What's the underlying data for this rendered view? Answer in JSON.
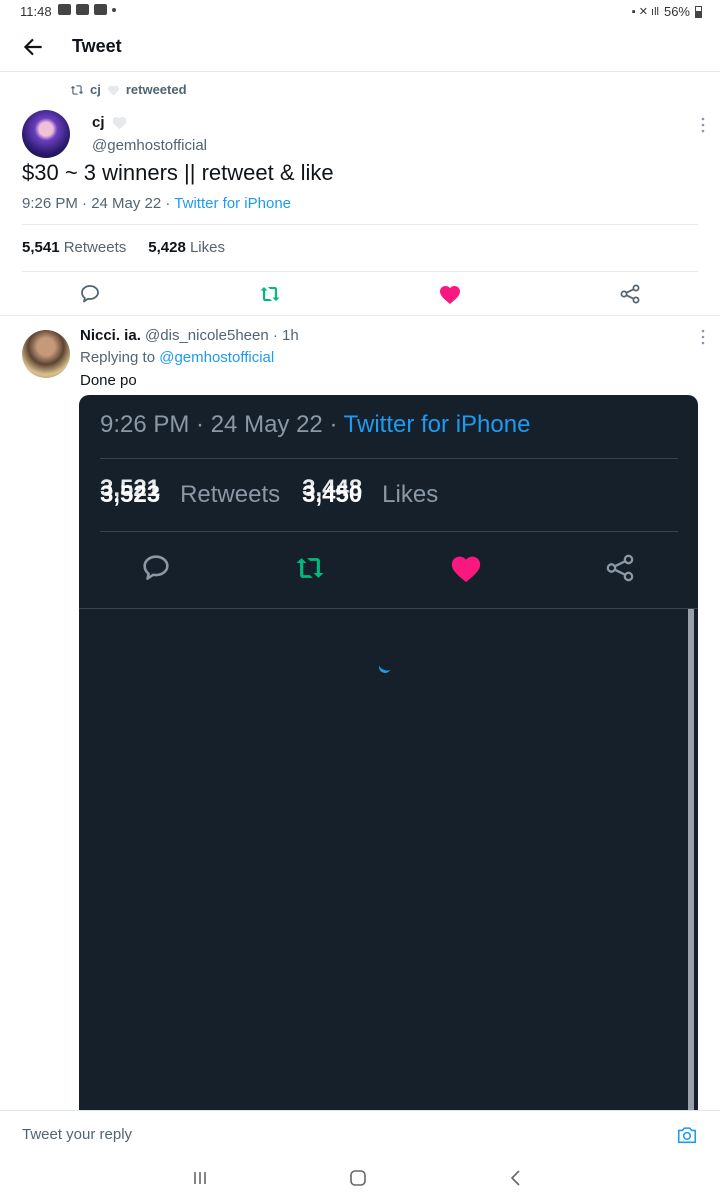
{
  "status_bar": {
    "time": "11:48",
    "battery": "56%"
  },
  "header": {
    "title": "Tweet"
  },
  "tweet": {
    "retweeted_by": "cj",
    "retweeted_label": "retweeted",
    "author_name": "cj",
    "author_handle": "@gemhostofficial",
    "text": "$30 ~ 3 winners || retweet & like",
    "timestamp": "9:26 PM · 24 May 22 · ",
    "source": "Twitter for iPhone",
    "retweets_count": "5,541",
    "retweets_label": "Retweets",
    "likes_count": "5,428",
    "likes_label": "Likes"
  },
  "reply": {
    "name": "Nicci. ia.",
    "handle_time": "@dis_nicole5heen · 1h",
    "replying_label": "Replying to",
    "replying_to": "@gemhostofficial",
    "text": "Done po",
    "media": {
      "timestamp": "9:26 PM · 24 May 22 · ",
      "source": "Twitter for iPhone",
      "retweets_count": "3,523",
      "retweets_count_overlay": "3,521",
      "retweets_label": "Retweets",
      "likes_count": "3,450",
      "likes_count_overlay": "3,448",
      "likes_label": "Likes"
    }
  },
  "compose": {
    "placeholder": "Tweet your reply"
  },
  "colors": {
    "accent": "#1d9bf0",
    "like": "#f91880",
    "retweet": "#00ba7c",
    "media_bg": "#15202b"
  }
}
